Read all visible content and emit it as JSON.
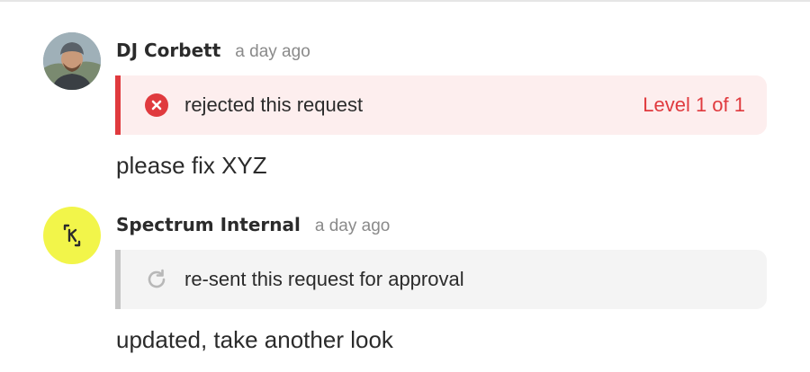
{
  "comments": [
    {
      "author": "DJ Corbett",
      "time": "a day ago",
      "avatar_icon": "user-photo-avatar",
      "action": {
        "type": "rejected",
        "icon": "x-circle-icon",
        "text": "rejected this request",
        "level": "Level 1 of 1",
        "accent_color": "#e03a3e",
        "background_color": "#fdeeee"
      },
      "message": "please fix XYZ"
    },
    {
      "author": "Spectrum Internal",
      "time": "a day ago",
      "avatar_icon": "k-logo-avatar",
      "avatar_color": "#f2f54a",
      "action": {
        "type": "resent",
        "icon": "refresh-icon",
        "text": "re-sent this request for approval",
        "accent_color": "#c5c5c5",
        "background_color": "#f4f4f4"
      },
      "message": "updated, take another look"
    }
  ]
}
